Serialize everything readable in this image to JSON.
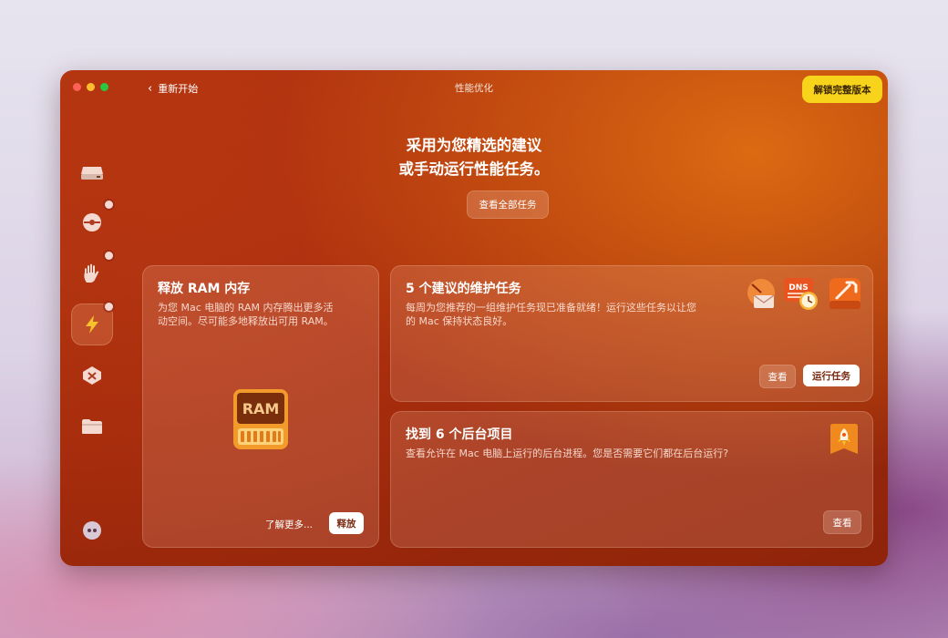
{
  "window": {
    "title": "性能优化",
    "back_label": "重新开始",
    "unlock_label": "解锁完整版本"
  },
  "sidebar": {
    "items": [
      {
        "icon": "disk-cleanup-icon",
        "badge": false,
        "active": false
      },
      {
        "icon": "protection-icon",
        "badge": true,
        "active": false
      },
      {
        "icon": "privacy-hand-icon",
        "badge": true,
        "active": false
      },
      {
        "icon": "lightning-icon",
        "badge": true,
        "active": true
      },
      {
        "icon": "applications-icon",
        "badge": false,
        "active": false
      },
      {
        "icon": "files-folder-icon",
        "badge": false,
        "active": false
      }
    ],
    "bottom_icon": "assistant-icon"
  },
  "header": {
    "line1": "采用为您精选的建议",
    "line2": "或手动运行性能任务。",
    "view_all_label": "查看全部任务"
  },
  "ram_card": {
    "title": "释放 RAM 内存",
    "desc_line1": "为您 Mac 电脑的 RAM 内存腾出更多活",
    "desc_line2": "动空间。尽可能多地释放出可用 RAM。",
    "icon_text": "RAM",
    "learn_more_label": "了解更多...",
    "free_label": "释放"
  },
  "maintenance_card": {
    "title": "5 个建议的维护任务",
    "desc_line1": "每周为您推荐的一组维护任务现已准备就绪！运行这些任务以让您",
    "desc_line2": "的 Mac 保持状态良好。",
    "dns_label": "DNS",
    "view_label": "查看",
    "run_label": "运行任务"
  },
  "background_card": {
    "title": "找到 6 个后台项目",
    "desc": "查看允许在 Mac 电脑上运行的后台进程。您是否需要它们都在后台运行?",
    "view_label": "查看"
  }
}
